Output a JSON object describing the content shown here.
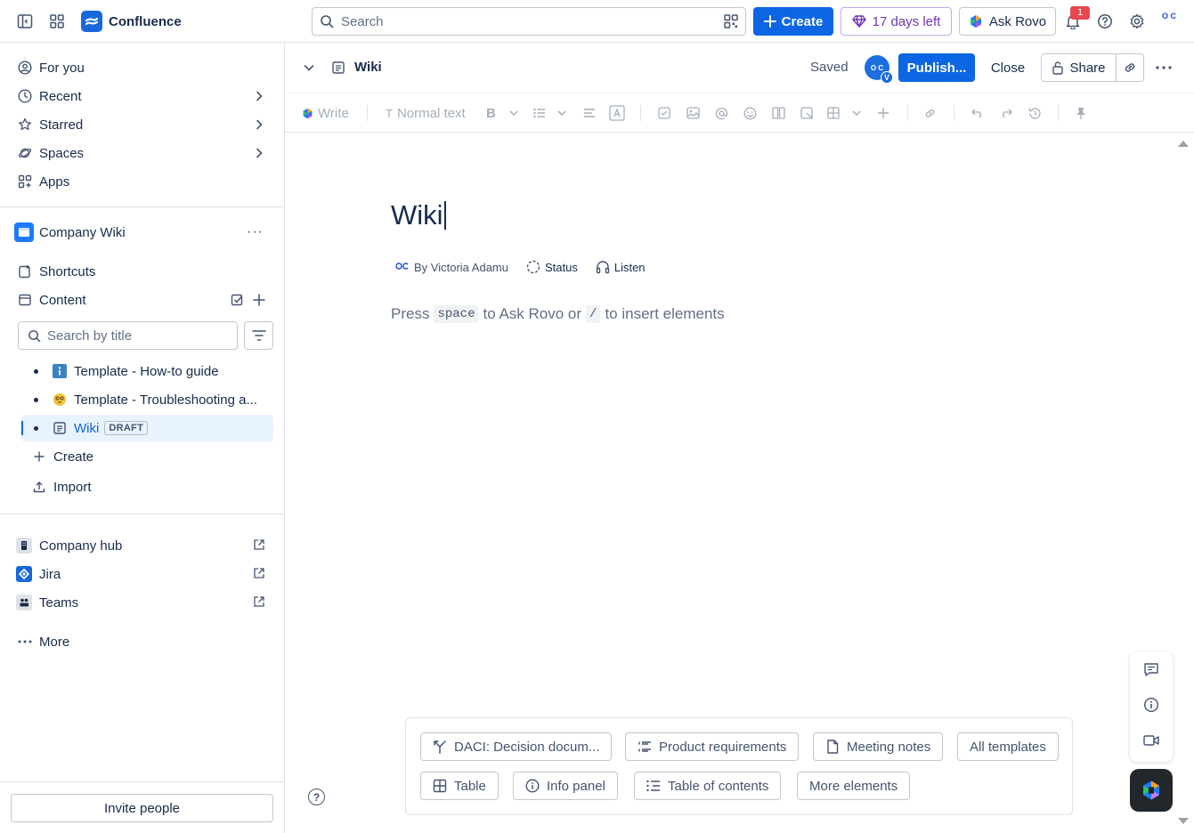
{
  "app": {
    "name": "Confluence"
  },
  "topbar": {
    "search_placeholder": "Search",
    "create_label": "Create",
    "trial_label": "17 days left",
    "rovo_label": "Ask Rovo",
    "notification_count": "1",
    "avatar_initials": "O C"
  },
  "sidebar": {
    "nav": [
      {
        "label": "For you"
      },
      {
        "label": "Recent"
      },
      {
        "label": "Starred"
      },
      {
        "label": "Spaces"
      },
      {
        "label": "Apps"
      }
    ],
    "space": {
      "name": "Company Wiki"
    },
    "shortcuts_label": "Shortcuts",
    "content_label": "Content",
    "search_placeholder": "Search by title",
    "tree": [
      {
        "label": "Template - How-to guide"
      },
      {
        "label": "Template - Troubleshooting a..."
      },
      {
        "label": "Wiki",
        "badge": "DRAFT"
      }
    ],
    "create_label": "Create",
    "import_label": "Import",
    "apps": [
      {
        "label": "Company hub"
      },
      {
        "label": "Jira"
      },
      {
        "label": "Teams"
      }
    ],
    "more_label": "More",
    "invite_label": "Invite people"
  },
  "editor": {
    "header": {
      "title": "Wiki",
      "saved_label": "Saved",
      "avatar_initials": "O C",
      "avatar_badge": "V",
      "publish_label": "Publish...",
      "close_label": "Close",
      "share_label": "Share"
    },
    "toolbar": {
      "write_label": "Write",
      "text_style_label": "Normal text"
    },
    "page_title": "Wiki",
    "byline": {
      "author": "By Victoria Adamu",
      "status_label": "Status",
      "listen_label": "Listen"
    },
    "placeholder": {
      "press": "Press",
      "key_space": "space",
      "middle": "to Ask Rovo or",
      "key_slash": "/",
      "end": "to insert elements"
    },
    "templates": [
      {
        "label": "DACI: Decision docum...",
        "icon": "daci-icon"
      },
      {
        "label": "Product requirements",
        "icon": "requirements-icon"
      },
      {
        "label": "Meeting notes",
        "icon": "document-icon"
      },
      {
        "label": "All templates",
        "icon": ""
      },
      {
        "label": "Table",
        "icon": "table-icon"
      },
      {
        "label": "Info panel",
        "icon": "info-icon"
      },
      {
        "label": "Table of contents",
        "icon": "toc-icon"
      },
      {
        "label": "More elements",
        "icon": ""
      }
    ]
  },
  "colors": {
    "brand": "#0c66e4",
    "trial": "#6e35b8",
    "selected_bg": "#e9f2ff",
    "notification": "#e5484d"
  }
}
